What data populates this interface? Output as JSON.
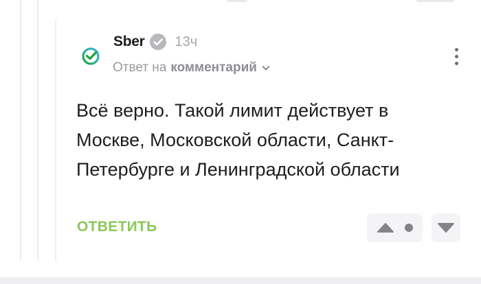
{
  "comment": {
    "author": "Sber",
    "time": "13ч",
    "reply_prefix": "Ответ на",
    "reply_target": "комментарий",
    "text": "Всё верно. Такой лимит действует в Москве, Московской области, Санкт-Петербурге и Ленинградской области",
    "reply_label": "ОТВЕТИТЬ",
    "verified_icon": "check-circle-icon"
  },
  "colors": {
    "accent_green": "#8ac858",
    "sber_green": "#21a038",
    "sber_cyan": "#41b7e8",
    "muted_text": "#9a9aa0"
  }
}
